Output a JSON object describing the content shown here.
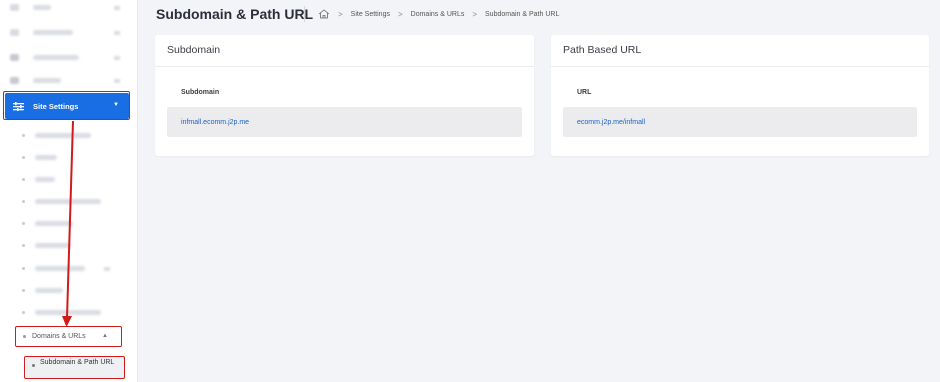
{
  "header": {
    "title": "Subdomain & Path URL",
    "breadcrumb": [
      "Site Settings",
      "Domains & URLs",
      "Subdomain & Path URL"
    ]
  },
  "sidebar": {
    "active_item": "Site Settings",
    "sub_group": "Domains & URLs",
    "sub_item": "Subdomain & Path URL"
  },
  "cards": {
    "subdomain": {
      "title": "Subdomain",
      "label": "Subdomain",
      "value": "infmall.ecomm.j2p.me"
    },
    "path": {
      "title": "Path Based URL",
      "label": "URL",
      "value": "ecomm.j2p.me/infmall"
    }
  },
  "colors": {
    "accent": "#1a6ee3",
    "highlight": "#d11a1a",
    "link": "#1a63c7"
  }
}
